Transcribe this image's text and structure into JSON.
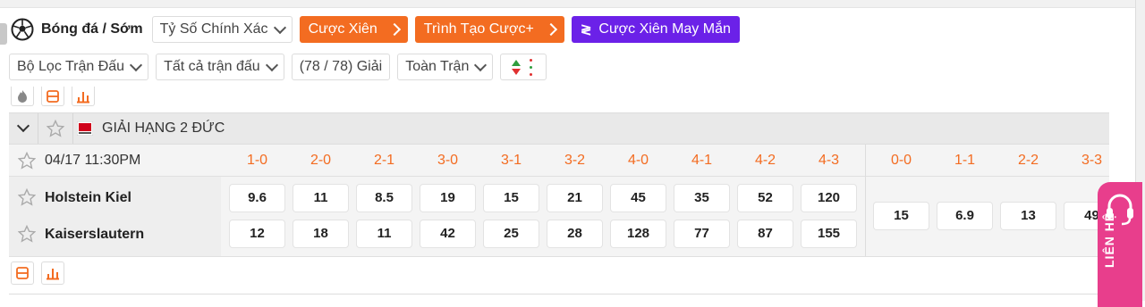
{
  "header": {
    "sport_title": "Bóng đá / Sớm",
    "market_select": "Tỷ Số Chính Xác",
    "parlay_button": "Cược Xiên",
    "bet_builder_button": "Trình Tạo Cược+",
    "lucky_parlay_button": "Cược Xiên May Mắn"
  },
  "filters": {
    "match_filter": "Bộ Lọc Trận Đấu",
    "all_matches": "Tất cả trận đấu",
    "league_count": "(78 / 78) Giải",
    "period": "Toàn Trận"
  },
  "league": {
    "name": "GIẢI HẠNG 2 ĐỨC"
  },
  "match": {
    "datetime": "04/17 11:30PM",
    "home_team": "Holstein Kiel",
    "away_team": "Kaiserslautern",
    "scores_win": [
      "1-0",
      "2-0",
      "2-1",
      "3-0",
      "3-1",
      "3-2",
      "4-0",
      "4-1",
      "4-2",
      "4-3"
    ],
    "home_odds": [
      "9.6",
      "11",
      "8.5",
      "19",
      "15",
      "21",
      "45",
      "35",
      "52",
      "120"
    ],
    "away_odds": [
      "12",
      "18",
      "11",
      "42",
      "25",
      "28",
      "128",
      "77",
      "87",
      "155"
    ],
    "scores_draw": [
      "0-0",
      "1-1",
      "2-2",
      "3-3"
    ],
    "draw_odds": [
      "15",
      "6.9",
      "13",
      "49"
    ]
  },
  "contact": {
    "label": "LIÊN HỆ"
  },
  "colors": {
    "accent_orange": "#f36c21",
    "accent_purple": "#6b21e8",
    "contact_pink": "#e83e8c"
  },
  "icons": [
    "soccer-ball-icon",
    "chevron-down-icon",
    "chevron-right-icon",
    "sort-icon",
    "fire-icon",
    "list-icon",
    "stats-icon",
    "star-icon",
    "league-flag-icon",
    "headset-icon"
  ]
}
